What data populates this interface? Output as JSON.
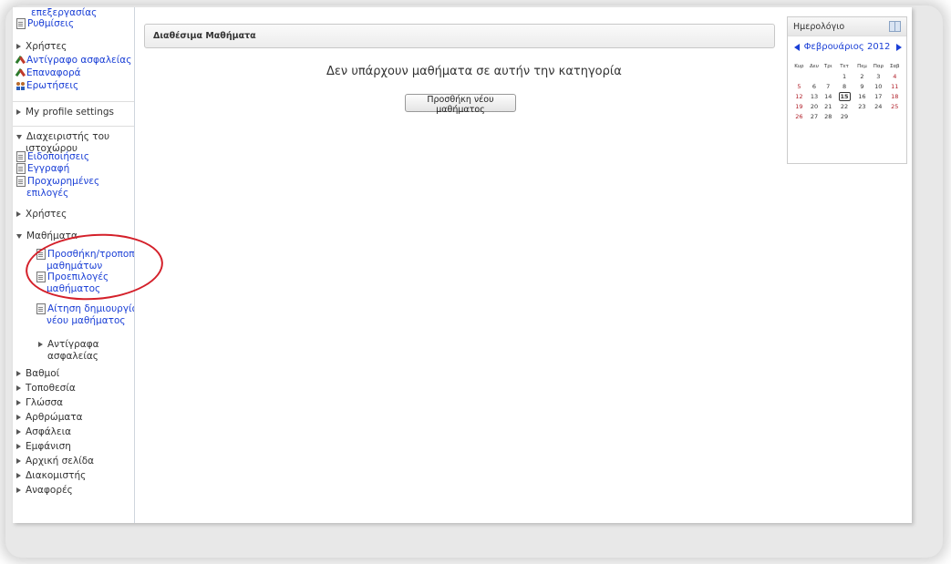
{
  "sidebar": {
    "items": [
      {
        "kind": "link",
        "indent": 1,
        "icon": "none",
        "lines": [
          "επεξεργασίας"
        ]
      },
      {
        "kind": "link",
        "indent": 0,
        "icon": "document-icon",
        "lines": [
          "Ρυθμίσεις"
        ]
      },
      {
        "kind": "text",
        "indent": 0,
        "icon": "expand-arrow-icon",
        "lines": [
          "Χρήστες"
        ]
      },
      {
        "kind": "link",
        "indent": 0,
        "icon": "tools-icon",
        "lines": [
          "Αντίγραφο ασφαλείας"
        ]
      },
      {
        "kind": "link",
        "indent": 0,
        "icon": "tools-icon",
        "lines": [
          "Επαναφορά"
        ]
      },
      {
        "kind": "link",
        "indent": 0,
        "icon": "users-icon",
        "lines": [
          "Ερωτήσεις"
        ]
      },
      {
        "kind": "text",
        "indent": 0,
        "icon": "expand-arrow-icon",
        "lines": [
          "My profile settings"
        ]
      },
      {
        "kind": "text",
        "indent": 0,
        "icon": "collapse-arrow-icon",
        "lines": [
          "Διαχειριστής του",
          "ιστοχώρου"
        ]
      },
      {
        "kind": "link",
        "indent": 0,
        "icon": "document-icon",
        "lines": [
          "Ειδοποιήσεις"
        ]
      },
      {
        "kind": "link",
        "indent": 0,
        "icon": "document-icon",
        "lines": [
          "Εγγραφή"
        ]
      },
      {
        "kind": "link",
        "indent": 0,
        "icon": "document-icon",
        "lines": [
          "Προχωρημένες",
          "επιλογές"
        ]
      },
      {
        "kind": "text",
        "indent": 0,
        "icon": "expand-arrow-icon",
        "lines": [
          "Χρήστες"
        ]
      },
      {
        "kind": "text",
        "indent": 0,
        "icon": "collapse-arrow-icon",
        "lines": [
          "Μαθήματα"
        ]
      },
      {
        "kind": "link",
        "indent": 1,
        "icon": "document-icon",
        "lines": [
          "Προσθήκη/τροποποίηση",
          "μαθημάτων"
        ]
      },
      {
        "kind": "link",
        "indent": 1,
        "icon": "document-icon",
        "lines": [
          "Προεπιλογές",
          "μαθήματος"
        ]
      },
      {
        "kind": "link",
        "indent": 1,
        "icon": "document-icon",
        "lines": [
          "Αίτηση δημιουργίας",
          "νέου μαθήματος"
        ]
      },
      {
        "kind": "text",
        "indent": 1,
        "icon": "expand-arrow-icon",
        "lines": [
          "Αντίγραφα",
          "ασφαλείας"
        ]
      },
      {
        "kind": "text",
        "indent": 0,
        "icon": "expand-arrow-icon",
        "lines": [
          "Βαθμοί"
        ]
      },
      {
        "kind": "text",
        "indent": 0,
        "icon": "expand-arrow-icon",
        "lines": [
          "Τοποθεσία"
        ]
      },
      {
        "kind": "text",
        "indent": 0,
        "icon": "expand-arrow-icon",
        "lines": [
          "Γλώσσα"
        ]
      },
      {
        "kind": "text",
        "indent": 0,
        "icon": "expand-arrow-icon",
        "lines": [
          "Αρθρώματα"
        ]
      },
      {
        "kind": "text",
        "indent": 0,
        "icon": "expand-arrow-icon",
        "lines": [
          "Ασφάλεια"
        ]
      },
      {
        "kind": "text",
        "indent": 0,
        "icon": "expand-arrow-icon",
        "lines": [
          "Εμφάνιση"
        ]
      },
      {
        "kind": "text",
        "indent": 0,
        "icon": "expand-arrow-icon",
        "lines": [
          "Αρχική σελίδα"
        ]
      },
      {
        "kind": "text",
        "indent": 0,
        "icon": "expand-arrow-icon",
        "lines": [
          "Διακομιστής"
        ]
      },
      {
        "kind": "text",
        "indent": 0,
        "icon": "expand-arrow-icon",
        "lines": [
          "Αναφορές"
        ]
      }
    ]
  },
  "main": {
    "header_title": "Διαθέσιμα Μαθήματα",
    "empty_message": "Δεν υπάρχουν μαθήματα σε αυτήν την κατηγορία",
    "add_course_label": "Προσθήκη νέου μαθήματος"
  },
  "calendar": {
    "title": "Ημερολόγιο",
    "month_label": "Φεβρουάριος 2012",
    "weekdays": [
      "Κυρ",
      "Δευ",
      "Τρι",
      "Τετ",
      "Πεμ",
      "Παρ",
      "Σαβ"
    ],
    "weeks": [
      [
        "",
        "",
        "",
        "1",
        "2",
        "3",
        "4"
      ],
      [
        "5",
        "6",
        "7",
        "8",
        "9",
        "10",
        "11"
      ],
      [
        "12",
        "13",
        "14",
        "15",
        "16",
        "17",
        "18"
      ],
      [
        "19",
        "20",
        "21",
        "22",
        "23",
        "24",
        "25"
      ],
      [
        "26",
        "27",
        "28",
        "29",
        "",
        "",
        ""
      ]
    ],
    "today": "15",
    "weekend_color": "#b0202a"
  },
  "colors": {
    "link": "#1a3fd6",
    "annotation": "#d4202a"
  }
}
